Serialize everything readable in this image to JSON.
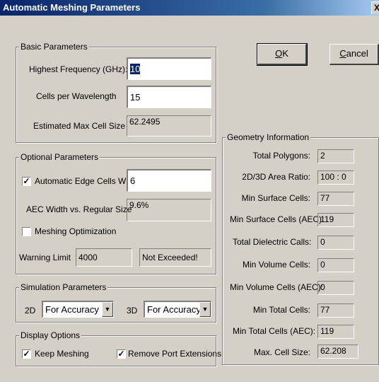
{
  "window": {
    "title": "Automatic Meshing Parameters",
    "close_glyph": "X"
  },
  "buttons": {
    "ok_u": "O",
    "ok_rest": "K",
    "cancel_u": "C",
    "cancel_rest": "ancel"
  },
  "basic": {
    "legend": "Basic Parameters",
    "highest_freq_label": "Highest Frequency (GHz):",
    "highest_freq_value": "10",
    "cells_per_wl_label": "Cells per Wavelength",
    "cells_per_wl_value": "15",
    "est_max_cell_label": "Estimated Max Cell Size",
    "est_max_cell_value": "62.2495"
  },
  "optional": {
    "legend": "Optional Parameters",
    "aec_width_label": "Automatic Edge Cells Width",
    "aec_width_checked": true,
    "aec_width_value": "6",
    "aec_vs_label": "AEC Width vs. Regular Size",
    "aec_vs_value": "9.6%",
    "mesh_opt_label": "Meshing Optimization",
    "mesh_opt_checked": false,
    "warning_label": "Warning Limit",
    "warning_value": "4000",
    "warning_status": "Not Exceeded!"
  },
  "simulation": {
    "legend": "Simulation Parameters",
    "d2_label": "2D",
    "d2_value": "For Accuracy",
    "d3_label": "3D",
    "d3_value": "For Accuracy"
  },
  "display": {
    "legend": "Display Options",
    "keep_meshing_label": "Keep Meshing",
    "keep_meshing_checked": true,
    "remove_port_label": "Remove Port Extensions",
    "remove_port_checked": true
  },
  "geometry": {
    "legend": "Geometry Information",
    "rows": [
      {
        "label": "Total Polygons:",
        "value": "2"
      },
      {
        "label": "2D/3D Area Ratio:",
        "value": "100 : 0"
      },
      {
        "label": "Min Surface Cells:",
        "value": "77"
      },
      {
        "label": "Min Surface Cells (AEC):",
        "value": "119"
      },
      {
        "label": "Total Dielectric Calls:",
        "value": "0"
      },
      {
        "label": "Min Volume Cells:",
        "value": "0"
      },
      {
        "label": "Min Volume Cells (AEC):",
        "value": "0"
      },
      {
        "label": "Min Total Cells:",
        "value": "77"
      },
      {
        "label": "Min Total Cells (AEC):",
        "value": "119"
      },
      {
        "label": "Max. Cell Size:",
        "value": "62.208"
      }
    ]
  },
  "glyphs": {
    "check": "✓",
    "dropdown": "▼"
  }
}
